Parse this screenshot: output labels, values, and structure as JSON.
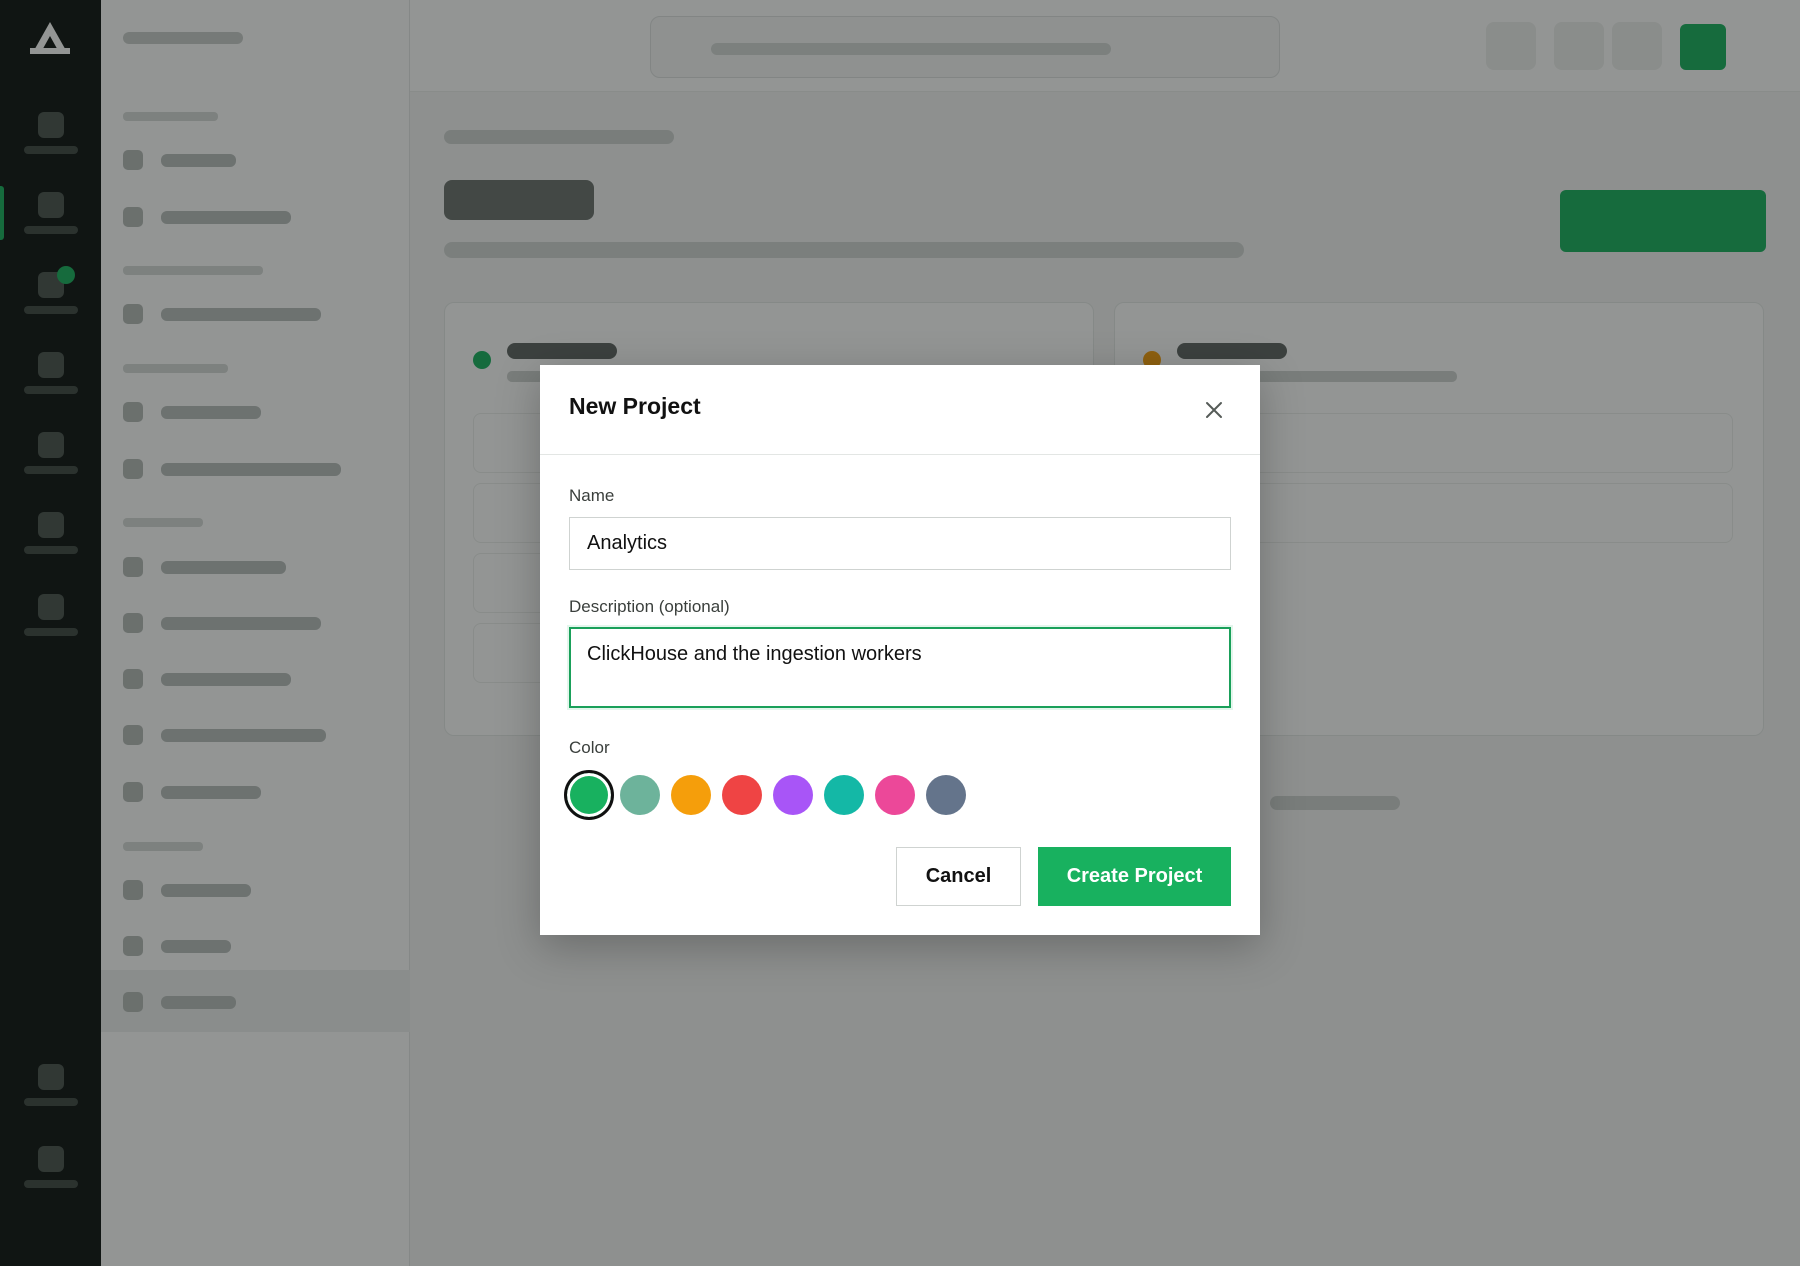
{
  "modal": {
    "title": "New Project",
    "close_icon": "close-icon",
    "name_label": "Name",
    "name_value": "Analytics",
    "description_label": "Description (optional)",
    "description_value": "ClickHouse and the ingestion workers",
    "color_label": "Color",
    "colors": [
      {
        "hex": "#18b15f",
        "selected": true
      },
      {
        "hex": "#6db39b",
        "selected": false
      },
      {
        "hex": "#f59e0b",
        "selected": false
      },
      {
        "hex": "#ef4444",
        "selected": false
      },
      {
        "hex": "#a855f7",
        "selected": false
      },
      {
        "hex": "#14b8a6",
        "selected": false
      },
      {
        "hex": "#ec4899",
        "selected": false
      },
      {
        "hex": "#64748b",
        "selected": false
      }
    ],
    "cancel_label": "Cancel",
    "create_label": "Create Project"
  },
  "theme": {
    "accent": "#18b15f",
    "overlay": "rgba(20,24,22,0.46)"
  }
}
